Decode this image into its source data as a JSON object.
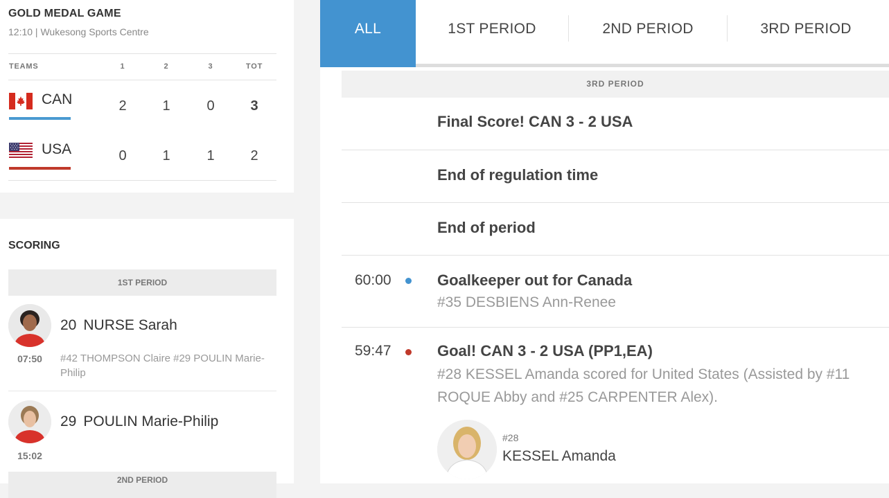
{
  "game": {
    "title": "GOLD MEDAL GAME",
    "subtitle": "12:10 | Wukesong Sports Centre",
    "headers": [
      "TEAMS",
      "1",
      "2",
      "3",
      "TOT"
    ],
    "teams": [
      {
        "abbr": "CAN",
        "p1": "2",
        "p2": "1",
        "p3": "0",
        "tot": "3",
        "bar_color": "#4a9ad1"
      },
      {
        "abbr": "USA",
        "p1": "0",
        "p2": "1",
        "p3": "1",
        "tot": "2",
        "bar_color": "#c0392b"
      }
    ]
  },
  "scoring": {
    "title": "SCORING",
    "period_label": "1ST PERIOD",
    "next_period_label": "2ND PERIOD",
    "goals": [
      {
        "number": "20",
        "name": "NURSE Sarah",
        "time": "07:50",
        "assists": "#42 THOMPSON Claire #29 POULIN Marie-Philip"
      },
      {
        "number": "29",
        "name": "POULIN Marie-Philip",
        "time": "15:02",
        "assists": ""
      }
    ]
  },
  "tabs": [
    "ALL",
    "1ST PERIOD",
    "2ND PERIOD",
    "3RD PERIOD"
  ],
  "pbp": {
    "period_header": "3RD PERIOD",
    "events": [
      {
        "time": "",
        "title": "Final Score! CAN 3 - 2 USA",
        "sub": ""
      },
      {
        "time": "",
        "title": "End of regulation time",
        "sub": ""
      },
      {
        "time": "",
        "title": "End of period",
        "sub": ""
      },
      {
        "time": "60:00",
        "title": "Goalkeeper out for Canada",
        "sub": "#35 DESBIENS Ann-Renee",
        "dot_color": "#4393d0"
      },
      {
        "time": "59:47",
        "title": "Goal! CAN 3 - 2 USA (PP1,EA)",
        "sub": "#28 KESSEL Amanda scored for United States (Assisted by #11 ROQUE Abby and #25 CARPENTER Alex).",
        "dot_color": "#c0392b"
      }
    ],
    "player": {
      "number": "#28",
      "name": "KESSEL Amanda"
    }
  }
}
